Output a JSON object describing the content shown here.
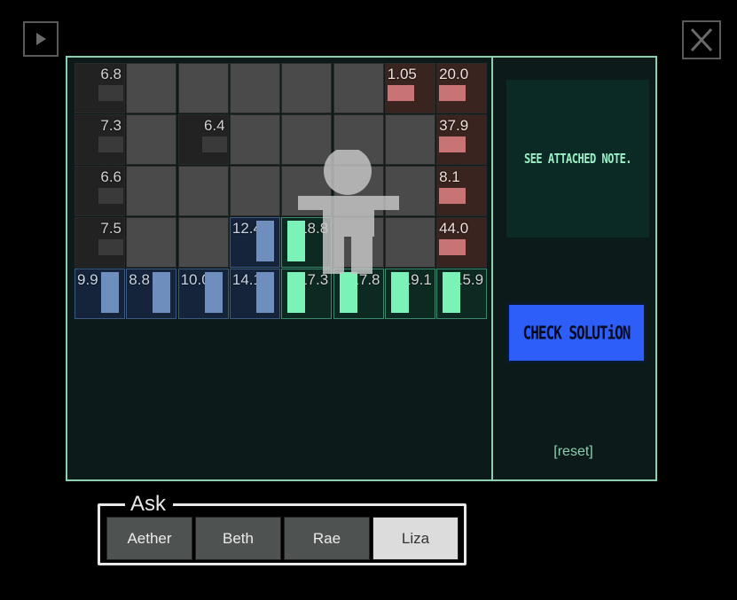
{
  "header": {
    "play_icon": "play-icon",
    "close_label": "X"
  },
  "note": {
    "text": "SEE ATTACHED NOTE."
  },
  "check_button": {
    "label": "CHECK SOLUTiON"
  },
  "reset": {
    "label": "[reset]"
  },
  "grid": {
    "rows": [
      [
        {
          "type": "dark",
          "value": "6.8",
          "bar": "h"
        },
        {
          "type": "gray"
        },
        {
          "type": "gray"
        },
        {
          "type": "gray"
        },
        {
          "type": "gray"
        },
        {
          "type": "gray"
        },
        {
          "type": "red",
          "value": "1.05",
          "bar": "h"
        },
        {
          "type": "red",
          "value": "20.0",
          "bar": "h"
        }
      ],
      [
        {
          "type": "dark",
          "value": "7.3",
          "bar": "h"
        },
        {
          "type": "gray"
        },
        {
          "type": "dark",
          "value": "6.4",
          "bar": "h"
        },
        {
          "type": "gray"
        },
        {
          "type": "gray"
        },
        {
          "type": "gray"
        },
        {
          "type": "gray"
        },
        {
          "type": "red",
          "value": "37.9",
          "bar": "h"
        }
      ],
      [
        {
          "type": "dark",
          "value": "6.6",
          "bar": "h"
        },
        {
          "type": "gray"
        },
        {
          "type": "gray"
        },
        {
          "type": "gray"
        },
        {
          "type": "gray"
        },
        {
          "type": "gray"
        },
        {
          "type": "gray"
        },
        {
          "type": "red",
          "value": "8.1",
          "bar": "h"
        }
      ],
      [
        {
          "type": "dark",
          "value": "7.5",
          "bar": "h"
        },
        {
          "type": "gray"
        },
        {
          "type": "gray"
        },
        {
          "type": "blue",
          "value": "12.4",
          "bar": "v"
        },
        {
          "type": "green",
          "value": "18.8",
          "bar": "v"
        },
        {
          "type": "gray"
        },
        {
          "type": "gray"
        },
        {
          "type": "red",
          "value": "44.0",
          "bar": "h"
        }
      ],
      [
        {
          "type": "blue",
          "value": "9.9",
          "bar": "v"
        },
        {
          "type": "blue",
          "value": "8.8",
          "bar": "v"
        },
        {
          "type": "blue",
          "value": "10.0",
          "bar": "v"
        },
        {
          "type": "blue",
          "value": "14.1",
          "bar": "v"
        },
        {
          "type": "green",
          "value": "17.3",
          "bar": "v"
        },
        {
          "type": "green",
          "value": "17.8",
          "bar": "v"
        },
        {
          "type": "green",
          "value": "19.1",
          "bar": "v"
        },
        {
          "type": "green",
          "value": "15.9",
          "bar": "v"
        }
      ]
    ]
  },
  "ask": {
    "label": "Ask",
    "options": [
      {
        "label": "Aether",
        "selected": false
      },
      {
        "label": "Beth",
        "selected": false
      },
      {
        "label": "Rae",
        "selected": false
      },
      {
        "label": "Liza",
        "selected": true
      }
    ]
  },
  "colors": {
    "panel_border": "#8ecfb0",
    "check_button": "#2d5ef7",
    "note_text": "#9ef0c8",
    "red_bar": "#c87474",
    "blue_bar": "#6e8fbe",
    "green_bar": "#7af2b8"
  }
}
